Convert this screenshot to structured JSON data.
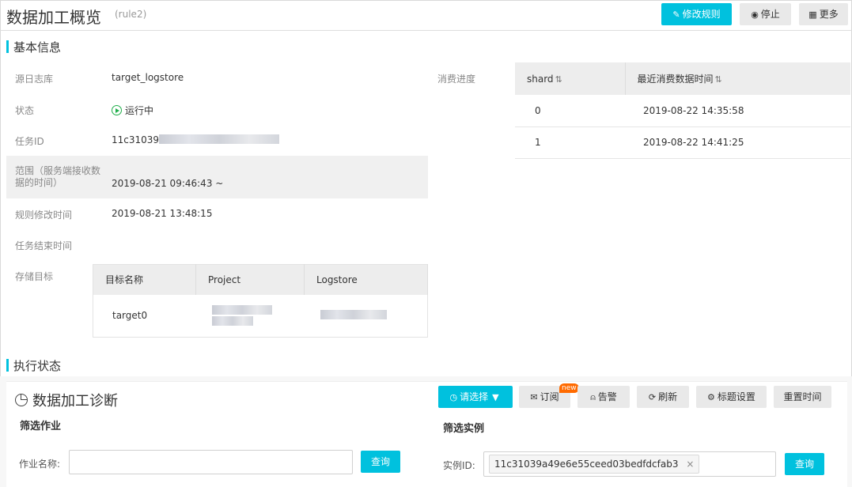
{
  "header": {
    "title": "数据加工概览",
    "subtitle": "(rule2)",
    "edit_button": "修改规则",
    "stop_button": "停止",
    "more_button": "更多"
  },
  "basic_info": {
    "section_title": "基本信息",
    "source_label": "源日志库",
    "source_value": "target_logstore",
    "status_label": "状态",
    "status_value": "运行中",
    "task_id_label": "任务ID",
    "task_id_value": "11c31039",
    "range_label": "范围（服务端接收数据的时间）",
    "range_value": "2019-08-21 09:46:43 ~",
    "modified_label": "规则修改时间",
    "modified_value": "2019-08-21 13:48:15",
    "end_label": "任务结束时间",
    "target_label": "存储目标",
    "progress_label": "消费进度"
  },
  "shard_table": {
    "headers": [
      "shard",
      "最近消费数据时间"
    ],
    "rows": [
      {
        "shard": "0",
        "time": "2019-08-22 14:35:58"
      },
      {
        "shard": "1",
        "time": "2019-08-22 14:41:25"
      }
    ]
  },
  "target_table": {
    "headers": [
      "目标名称",
      "Project",
      "Logstore"
    ],
    "rows": [
      {
        "name": "target0",
        "project": "",
        "logstore": ""
      }
    ]
  },
  "exec_status": {
    "section_title": "执行状态"
  },
  "diagnosis": {
    "title": "数据加工诊断",
    "select_button": "请选择",
    "subscribe_button": "订阅",
    "new_badge": "new",
    "alert_button": "告警",
    "refresh_button": "刷新",
    "title_settings_button": "标题设置",
    "reset_time_button": "重置时间",
    "filter_job_title": "筛选作业",
    "job_name_label": "作业名称:",
    "job_name_value": "",
    "query_button": "查询",
    "filter_instance_title": "筛选实例",
    "instance_label": "实例ID:",
    "instance_tag": "11c31039a49e6e55ceed03bedfdcfab3",
    "instance_query_button": "查询"
  },
  "colors": {
    "accent": "#00c1de",
    "running": "#1fae4a",
    "badge": "#ff6a00"
  }
}
